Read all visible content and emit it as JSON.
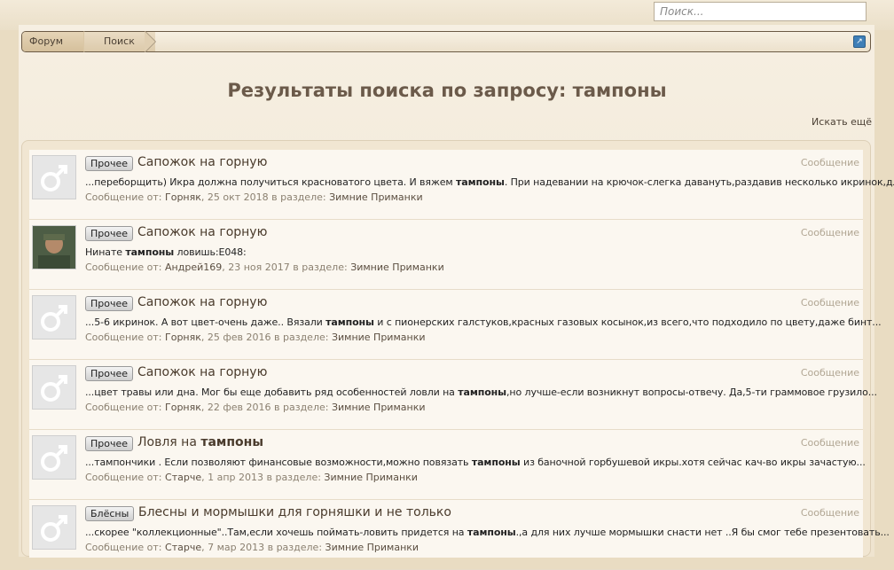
{
  "search": {
    "placeholder": "Поиск..."
  },
  "breadcrumb": {
    "items": [
      "Форум",
      "Поиск"
    ]
  },
  "page_title": "Результаты поиска по запросу: тампоны",
  "search_more": "Искать ещё",
  "results": [
    {
      "prefix": "Прочее",
      "title_before": "Сапожок на горную",
      "title_bold": "",
      "title_after": "",
      "snip_before": "...переборщить) Икра должна получиться красноватого цвета. И вяжем ",
      "snip_bold": "тампоны",
      "snip_after": ". При надевании на крючок-слегка давануть,раздавив несколько икринок,для...",
      "meta_label": "Сообщение от:",
      "author": "Горняк",
      "date": ", 25 окт 2018 в разделе:",
      "forum": "Зимние Приманки",
      "type": "Сообщение",
      "avatar": "default"
    },
    {
      "prefix": "Прочее",
      "title_before": "Сапожок на горную",
      "title_bold": "",
      "title_after": "",
      "snip_before": "Нинате ",
      "snip_bold": "тампоны",
      "snip_after": " ловишь:E048:",
      "meta_label": "Сообщение от:",
      "author": "Андрей169",
      "date": ", 23 ноя 2017 в разделе:",
      "forum": "Зимние Приманки",
      "type": "Сообщение",
      "avatar": "photo"
    },
    {
      "prefix": "Прочее",
      "title_before": "Сапожок на горную",
      "title_bold": "",
      "title_after": "",
      "snip_before": "...5-6 икринок. А вот цвет-очень даже.. Вязали ",
      "snip_bold": "тампоны",
      "snip_after": " и с пионерских галстуков,красных газовых косынок,из всего,что подходило по цвету,даже бинт...",
      "meta_label": "Сообщение от:",
      "author": "Горняк",
      "date": ", 25 фев 2016 в разделе:",
      "forum": "Зимние Приманки",
      "type": "Сообщение",
      "avatar": "default"
    },
    {
      "prefix": "Прочее",
      "title_before": "Сапожок на горную",
      "title_bold": "",
      "title_after": "",
      "snip_before": "...цвет травы или дна. Мог бы еще добавить ряд особенностей ловли на ",
      "snip_bold": "тампоны",
      "snip_after": ",но лучше-если возникнут вопросы-отвечу. Да,5-ти граммовое грузило...",
      "meta_label": "Сообщение от:",
      "author": "Горняк",
      "date": ", 22 фев 2016 в разделе:",
      "forum": "Зимние Приманки",
      "type": "Сообщение",
      "avatar": "default"
    },
    {
      "prefix": "Прочее",
      "title_before": "Ловля на ",
      "title_bold": "тампоны",
      "title_after": "",
      "snip_before": "...тампончики . Если позволяют финансовые возможности,можно повязать ",
      "snip_bold": "тампоны",
      "snip_after": " из баночной горбушевой икры.хотя сейчас кач-во икры зачастую...",
      "meta_label": "Сообщение от:",
      "author": "Старче",
      "date": ", 1 апр 2013 в разделе:",
      "forum": "Зимние Приманки",
      "type": "Сообщение",
      "avatar": "default"
    },
    {
      "prefix": "Блёсны",
      "title_before": "Блесны и мормышки для горняшки и не только",
      "title_bold": "",
      "title_after": "",
      "snip_before": "...скорее \"коллекционные\"..Там,если хочешь поймать-ловить придется на ",
      "snip_bold": "тампоны",
      "snip_after": ".,а для них лучше мормышки снасти нет ..Я бы смог тебе презентовать...",
      "meta_label": "Сообщение от:",
      "author": "Старче",
      "date": ", 7 мар 2013 в разделе:",
      "forum": "Зимние Приманки",
      "type": "Сообщение",
      "avatar": "default"
    }
  ]
}
